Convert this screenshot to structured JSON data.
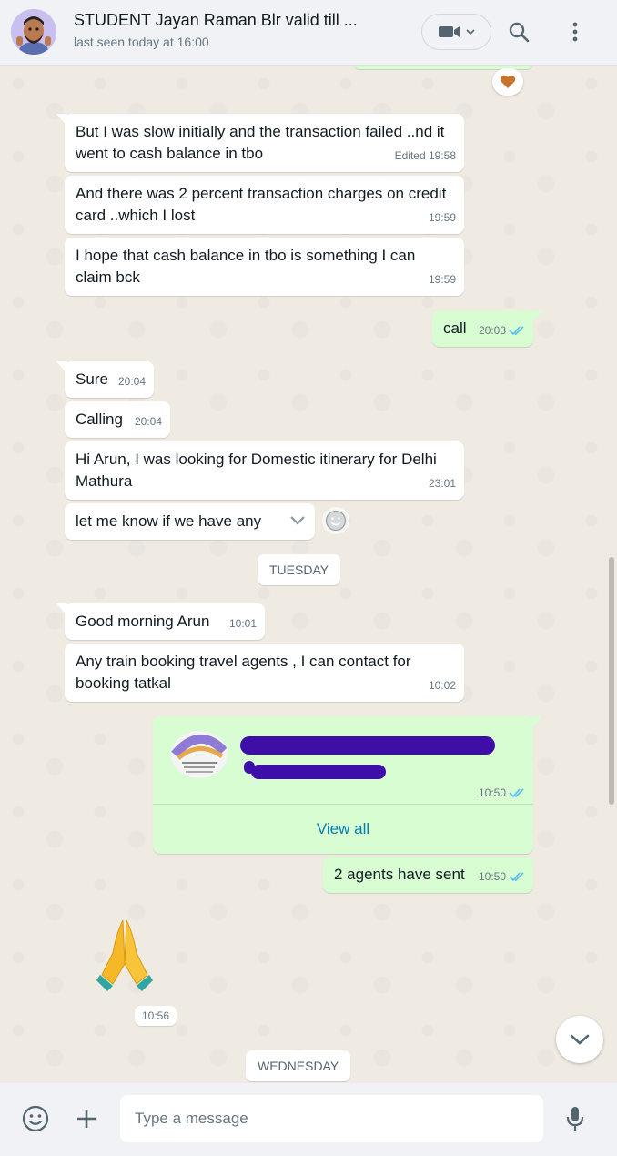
{
  "header": {
    "title": "STUDENT Jayan Raman Blr valid till ...",
    "status": "last seen today at 16:00"
  },
  "messages": {
    "m1": {
      "text": "But I was slow initially and the transaction failed ..nd it went to cash balance in tbo",
      "time": "Edited 19:58"
    },
    "m2": {
      "text": "And there was 2 percent transaction charges on credit card ..which I lost",
      "time": "19:59"
    },
    "m3": {
      "text": "I hope that cash balance in tbo is something I can claim bck",
      "time": "19:59"
    },
    "m4": {
      "text": "call",
      "time": "20:03"
    },
    "m5": {
      "text": "Sure",
      "time": "20:04"
    },
    "m6": {
      "text": "Calling",
      "time": "20:04"
    },
    "m7": {
      "text": "Hi Arun, I was looking for Domestic itinerary for Delhi Mathura",
      "time": "23:01"
    },
    "m8": {
      "text": "let me know if we have any"
    },
    "m9": {
      "text": "Good morning Arun",
      "time": "10:01"
    },
    "m10": {
      "text": "Any train booking travel agents , I can contact for booking tatkal",
      "time": "10:02"
    },
    "m11": {
      "time": "10:50",
      "link_label": "View all"
    },
    "m12": {
      "text": "2 agents have sent",
      "time": "10:50"
    },
    "m13": {
      "emoji": "🙏",
      "time": "10:56"
    }
  },
  "dividers": {
    "tuesday": "TUESDAY",
    "wednesday": "WEDNESDAY"
  },
  "footer": {
    "placeholder": "Type a message"
  },
  "colors": {
    "outgoing": "#d9fdd3",
    "incoming": "#ffffff",
    "read_tick": "#53bdeb",
    "link": "#027eb5",
    "redaction": "#3d0fa8"
  }
}
